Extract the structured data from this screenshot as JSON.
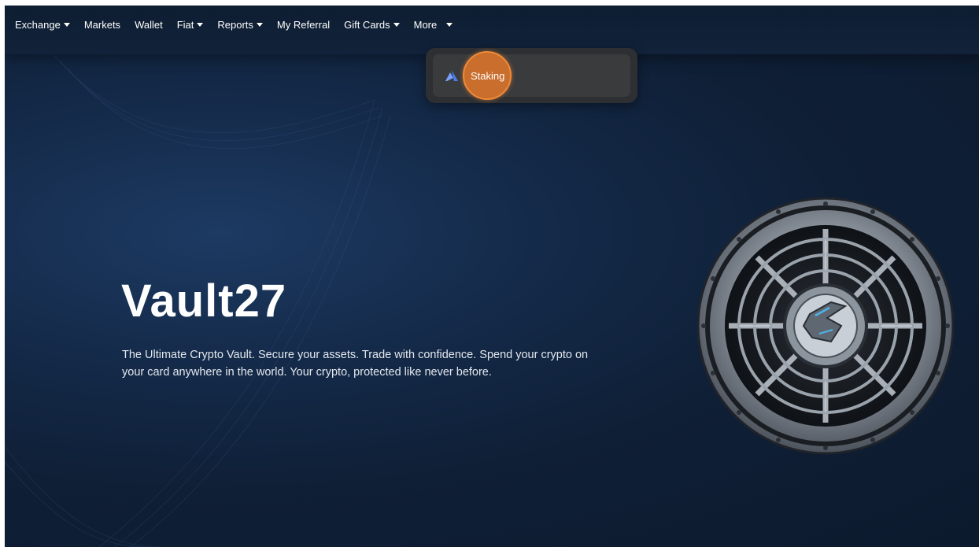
{
  "nav": {
    "items": [
      {
        "label": "Exchange",
        "has_caret": true
      },
      {
        "label": "Markets",
        "has_caret": false
      },
      {
        "label": "Wallet",
        "has_caret": false
      },
      {
        "label": "Fiat",
        "has_caret": true
      },
      {
        "label": "Reports",
        "has_caret": true
      },
      {
        "label": "My Referral",
        "has_caret": false
      },
      {
        "label": "Gift Cards",
        "has_caret": true
      },
      {
        "label": "More",
        "has_caret": true
      }
    ]
  },
  "dropdown": {
    "items": [
      {
        "label": "Staking",
        "icon": "staking-icon"
      }
    ]
  },
  "hero": {
    "title": "Vault27",
    "description": "The Ultimate Crypto Vault. Secure your assets. Trade with confidence. Spend your crypto on your card anywhere in the world. Your crypto, protected like never before."
  },
  "colors": {
    "background": "#0f1f36",
    "click_indicator": "#e97a2a",
    "staking_icon": "#4a7bf0"
  }
}
